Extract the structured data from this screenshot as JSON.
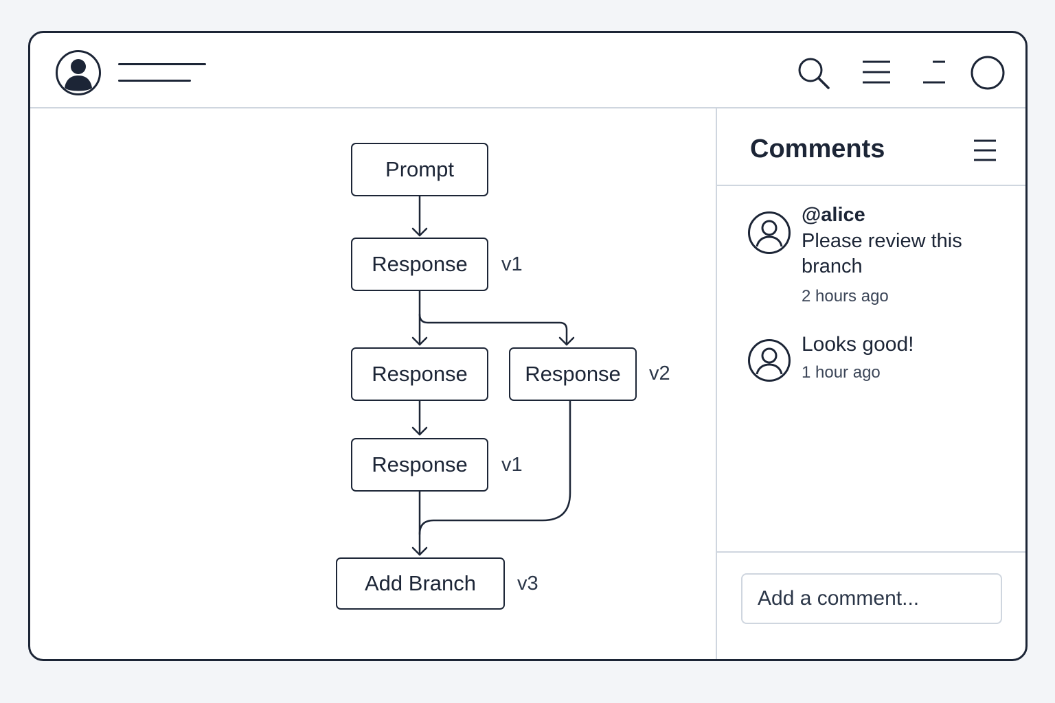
{
  "flow": {
    "prompt_label": "Prompt",
    "response1_label": "Response",
    "response1_version": "v1",
    "response2a_label": "Response",
    "response2b_label": "Response",
    "response2b_version": "v2",
    "response3_label": "Response",
    "response3_version": "v1",
    "add_branch_label": "Add Branch",
    "add_branch_version": "v3"
  },
  "comments": {
    "title": "Comments",
    "items": [
      {
        "user": "@alice",
        "text_line1": "Please review this",
        "text_line2": "branch",
        "time": "2 hours ago"
      },
      {
        "text": "Looks good!",
        "time": "1 hour ago"
      }
    ],
    "input_placeholder": "Add a comment..."
  },
  "colors": {
    "stroke": "#1c2536",
    "divider": "#cfd6df",
    "background": "#f3f5f8"
  }
}
